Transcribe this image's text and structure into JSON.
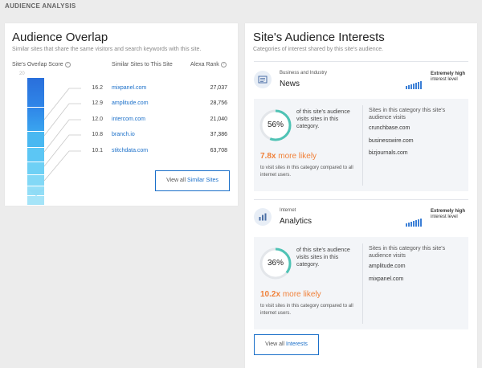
{
  "section_title": "AUDIENCE ANALYSIS",
  "overlap": {
    "title": "Audience Overlap",
    "subtitle": "Similar sites that share the same visitors and search keywords with this site.",
    "col_score": "Site's Overlap Score",
    "col_sites": "Similar Sites to This Site",
    "col_rank": "Alexa Rank",
    "help_glyph": "?",
    "funnel_top": "20",
    "rows": [
      {
        "score": "16.2",
        "site": "mixpanel.com",
        "rank": "27,037"
      },
      {
        "score": "12.9",
        "site": "amplitude.com",
        "rank": "28,756"
      },
      {
        "score": "12.0",
        "site": "intercom.com",
        "rank": "21,040"
      },
      {
        "score": "10.8",
        "site": "branch.io",
        "rank": "37,386"
      },
      {
        "score": "10.1",
        "site": "stitchdata.com",
        "rank": "63,708"
      }
    ],
    "button_prefix": "View all",
    "button_link": "Similar Sites"
  },
  "interests": {
    "title": "Site's Audience Interests",
    "subtitle": "Categories of interest shared by this site's audience.",
    "categories": [
      {
        "icon": "newspaper-icon",
        "parent": "Business and Industry",
        "name": "News",
        "level_strong": "Extremely high",
        "level_rest": "interest level",
        "percent": "56%",
        "percent_value": 56,
        "ring_text": "of this site's audience visits sites in this category.",
        "likely_value": "7.8x",
        "likely_text": "more likely",
        "likely_sub": "to visit sites in this category compared to all internet users.",
        "sites_head": "Sites in this category this site's audience visits",
        "sites": [
          "crunchbase.com",
          "businesswire.com",
          "bizjournals.com"
        ]
      },
      {
        "icon": "chart-icon",
        "parent": "Internet",
        "name": "Analytics",
        "level_strong": "Extremely high",
        "level_rest": "interest level",
        "percent": "36%",
        "percent_value": 36,
        "ring_text": "of this site's audience visits sites in this category.",
        "likely_value": "10.2x",
        "likely_text": "more likely",
        "likely_sub": "to visit sites in this category compared to all internet users.",
        "sites_head": "Sites in this category this site's audience visits",
        "sites": [
          "amplitude.com",
          "mixpanel.com"
        ]
      }
    ],
    "button_prefix": "View all",
    "button_link": "Interests"
  },
  "colors": {
    "accent": "#1a6fc9",
    "orange": "#f0813a",
    "ring_track": "#e3e6ea",
    "ring_fill": "#4fc3b5"
  }
}
